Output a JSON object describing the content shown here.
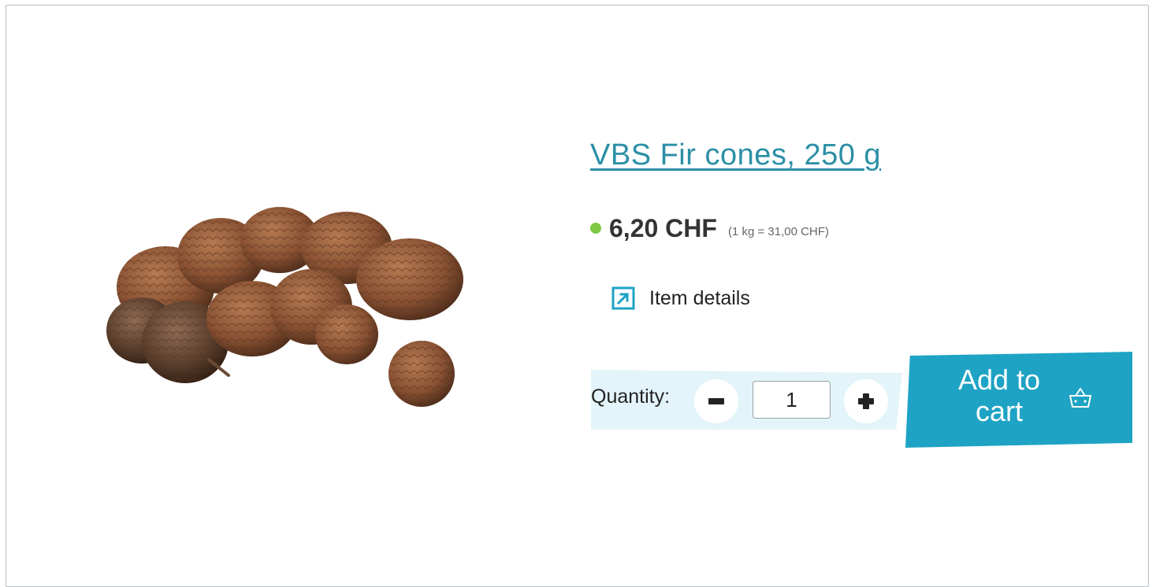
{
  "product": {
    "title": "VBS Fir cones, 250 g",
    "price": "6,20 CHF",
    "unit_price": "(1 kg = 31,00 CHF)",
    "availability_color": "#7fc843",
    "image_icon": "pine-cones-image"
  },
  "details_link": {
    "label": "Item details",
    "icon": "external-link-icon"
  },
  "quantity": {
    "label": "Quantity:",
    "value": "1",
    "decrease_icon": "minus-icon",
    "increase_icon": "plus-icon"
  },
  "cart_button": {
    "label": "Add to cart",
    "icon": "basket-icon"
  },
  "colors": {
    "accent": "#1ea3c4",
    "title": "#2b8fa6",
    "quantity_band": "#e3f4fa",
    "availability": "#7fc843"
  }
}
